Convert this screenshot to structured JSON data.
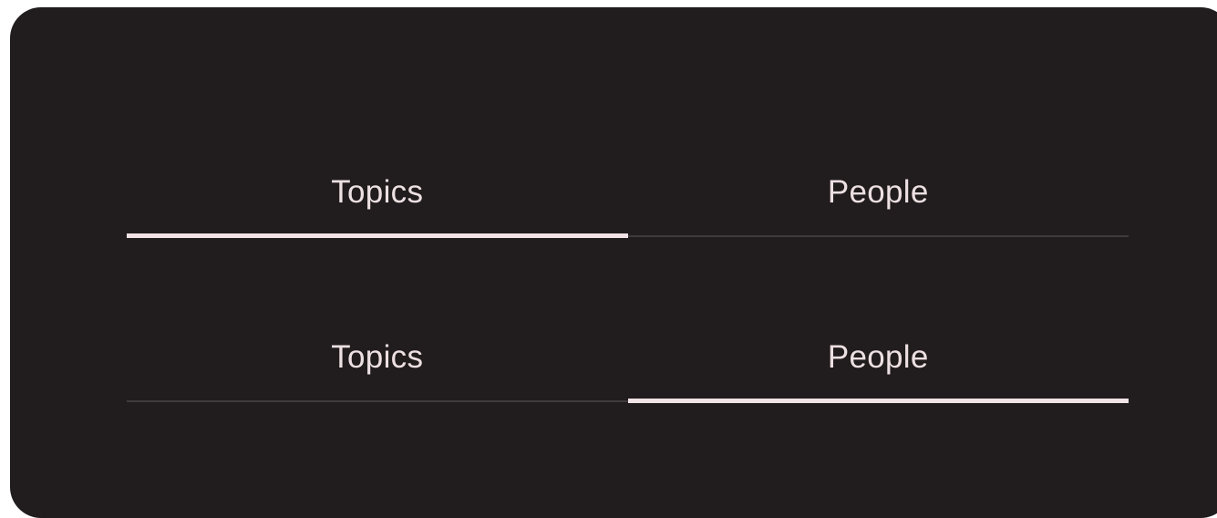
{
  "tab_groups": [
    {
      "tabs": [
        {
          "label": "Topics",
          "selected": true
        },
        {
          "label": "People",
          "selected": false
        }
      ]
    },
    {
      "tabs": [
        {
          "label": "Topics",
          "selected": false
        },
        {
          "label": "People",
          "selected": true
        }
      ]
    }
  ],
  "colors": {
    "surface": "#211c1d",
    "label": "#ece0e2",
    "indicator_selected": "#f2e3e6",
    "divider": "#3f3a3b"
  }
}
